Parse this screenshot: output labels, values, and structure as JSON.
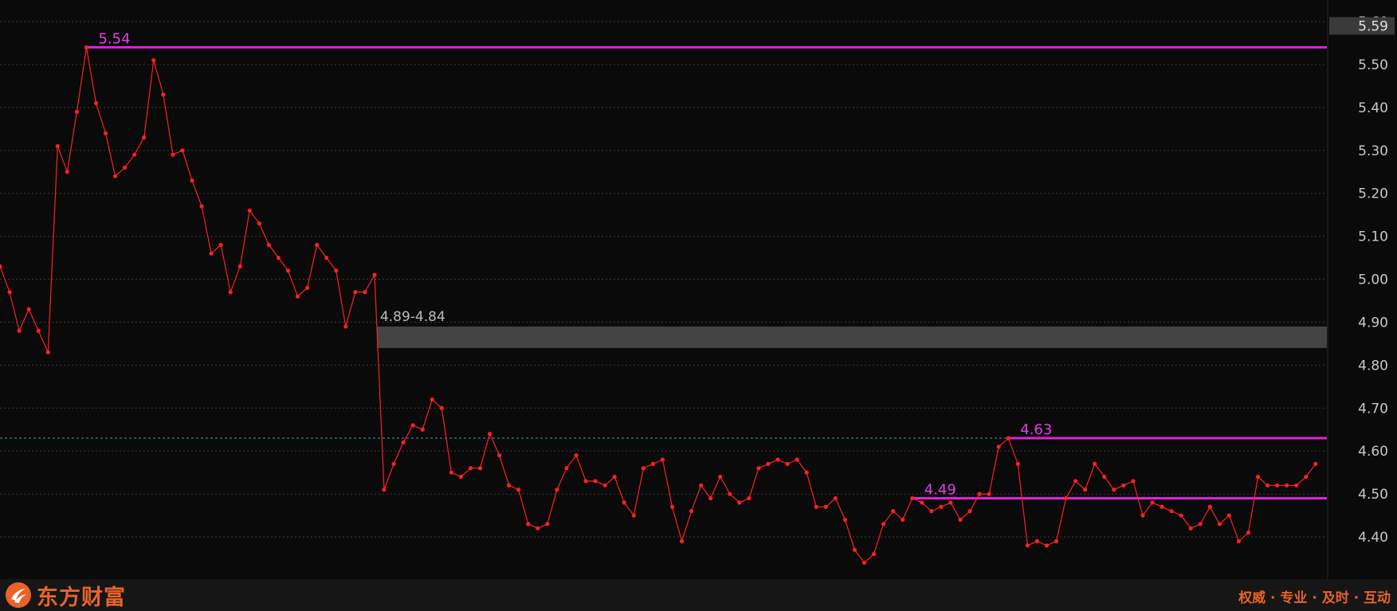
{
  "chart_data": {
    "type": "line",
    "y_axis": {
      "min": 4.3,
      "max": 5.6,
      "ticks": [
        "5.60",
        "5.50",
        "5.40",
        "5.30",
        "5.20",
        "5.10",
        "5.00",
        "4.90",
        "4.80",
        "4.70",
        "4.60",
        "4.50",
        "4.40"
      ]
    },
    "current_price_label": "5.59",
    "series": [
      {
        "values": [
          5.03,
          4.97,
          4.88,
          4.93,
          4.88,
          4.83,
          5.31,
          5.25,
          5.39,
          5.54,
          5.41,
          5.34,
          5.24,
          5.26,
          5.29,
          5.33,
          5.51,
          5.43,
          5.29,
          5.3,
          5.23,
          5.17,
          5.06,
          5.08,
          4.97,
          5.03,
          5.16,
          5.13,
          5.08,
          5.05,
          5.02,
          4.96,
          4.98,
          5.08,
          5.05,
          5.02,
          4.89,
          4.97,
          4.97,
          5.01,
          4.51,
          4.57,
          4.62,
          4.66,
          4.65,
          4.72,
          4.7,
          4.55,
          4.54,
          4.56,
          4.56,
          4.64,
          4.59,
          4.52,
          4.51,
          4.43,
          4.42,
          4.43,
          4.51,
          4.56,
          4.59,
          4.53,
          4.53,
          4.52,
          4.54,
          4.48,
          4.45,
          4.56,
          4.57,
          4.58,
          4.47,
          4.39,
          4.46,
          4.52,
          4.49,
          4.54,
          4.5,
          4.48,
          4.49,
          4.56,
          4.57,
          4.58,
          4.57,
          4.58,
          4.55,
          4.47,
          4.47,
          4.49,
          4.44,
          4.37,
          4.34,
          4.36,
          4.43,
          4.46,
          4.44,
          4.49,
          4.48,
          4.46,
          4.47,
          4.48,
          4.44,
          4.46,
          4.5,
          4.5,
          4.61,
          4.63,
          4.57,
          4.38,
          4.39,
          4.38,
          4.39,
          4.49,
          4.53,
          4.51,
          4.57,
          4.54,
          4.51,
          4.52,
          4.53,
          4.45,
          4.48,
          4.47,
          4.46,
          4.45,
          4.42,
          4.43,
          4.47,
          4.43,
          4.45,
          4.39,
          4.41,
          4.54,
          4.52,
          4.52,
          4.52,
          4.52,
          4.54,
          4.57
        ]
      }
    ],
    "resistance_lines": [
      {
        "label": "5.54",
        "value": 5.54,
        "start_index": 9
      },
      {
        "label": "4.63",
        "value": 4.63,
        "start_index": 105
      },
      {
        "label": "4.49",
        "value": 4.49,
        "start_index": 95
      }
    ],
    "zone": {
      "label": "4.89-4.84",
      "high": 4.89,
      "low": 4.84,
      "start_index": 39
    },
    "reference_line": {
      "value": 4.63
    },
    "colors": {
      "background": "#0a0a0a",
      "price_line": "#ff2020",
      "level_line": "#e020e0",
      "level_label": "#e040e0",
      "zone_fill": "#444444",
      "zone_label": "#bbbbbb",
      "grid": "#3a3a3a",
      "axis_text": "#c8c8c8",
      "reference": "#3aa0b0"
    }
  },
  "footer": {
    "brand": "东方财富",
    "slogan": "权威 · 专业 · 及时 · 互动",
    "logo_icon": "eastmoney-logo-icon"
  }
}
